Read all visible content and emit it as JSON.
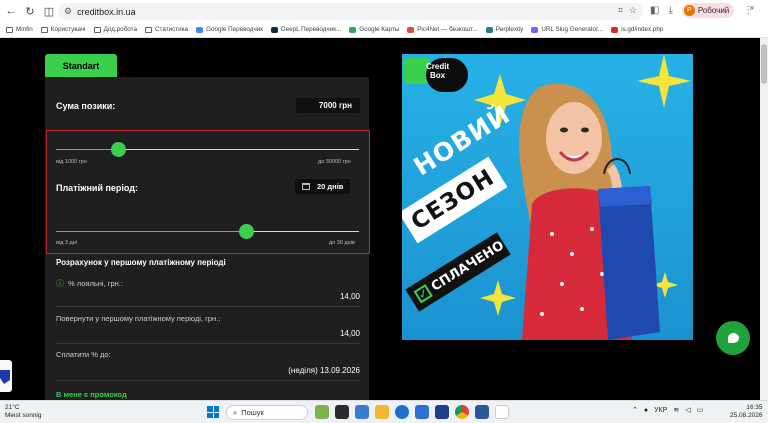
{
  "browser": {
    "url": "creditbox.in.ua",
    "profile_label": "Робочий",
    "profile_initial": "Р",
    "bookmarks": [
      {
        "label": "Minfin",
        "color": ""
      },
      {
        "label": "Користувачі",
        "color": ""
      },
      {
        "label": "Дод.робота",
        "color": ""
      },
      {
        "label": "Статистика",
        "color": ""
      },
      {
        "label": "Google Переводчик",
        "color": "#4285f4"
      },
      {
        "label": "DeepL Переводчик...",
        "color": "#0f2b46"
      },
      {
        "label": "Google Карты",
        "color": "#34a853"
      },
      {
        "label": "Pic4Net — безкошт...",
        "color": "#e8453c"
      },
      {
        "label": "Perplexity",
        "color": "#20808d"
      },
      {
        "label": "URL Slug Generator...",
        "color": "#7b5cff"
      },
      {
        "label": "is.gd/index.php",
        "color": "#d32f2f"
      }
    ],
    "more": "»"
  },
  "loan": {
    "tab_label": "Standart",
    "amount_label": "Сума позики:",
    "amount_value": "7000 грн",
    "amount_min": "від 1000 грн",
    "amount_max": "до 30000 грн",
    "amount_slider_fraction": 0.2069,
    "period_label": "Платіжний період:",
    "period_value": "20 днів",
    "period_min": "від 3 дні",
    "period_max": "до 30 днів",
    "period_slider_fraction": 0.6296,
    "calc_title": "Розрахунок у першому платіжному періоді",
    "loyal_label": "% лояльні, грн.:",
    "loyal_value": "14,00",
    "return_label": "Повернути у першому платіжному періоді, грн.:",
    "return_value": "14,00",
    "pay_label": "Сплатити % до:",
    "pay_value": "(неділя) 13.09.2026",
    "promo_label": "В мене є промокод"
  },
  "banner": {
    "logo_line1": "Credit",
    "logo_line2": "Box",
    "text1": "НОВИЙ",
    "text2": "СЕЗОН",
    "text3": "СПЛАЧЕНО"
  },
  "taskbar": {
    "temp": "21°C",
    "weather": "Meist sonnig",
    "search_placeholder": "Пошук",
    "lang": "УКР",
    "time": "16:35",
    "date": "25.08.2026"
  }
}
